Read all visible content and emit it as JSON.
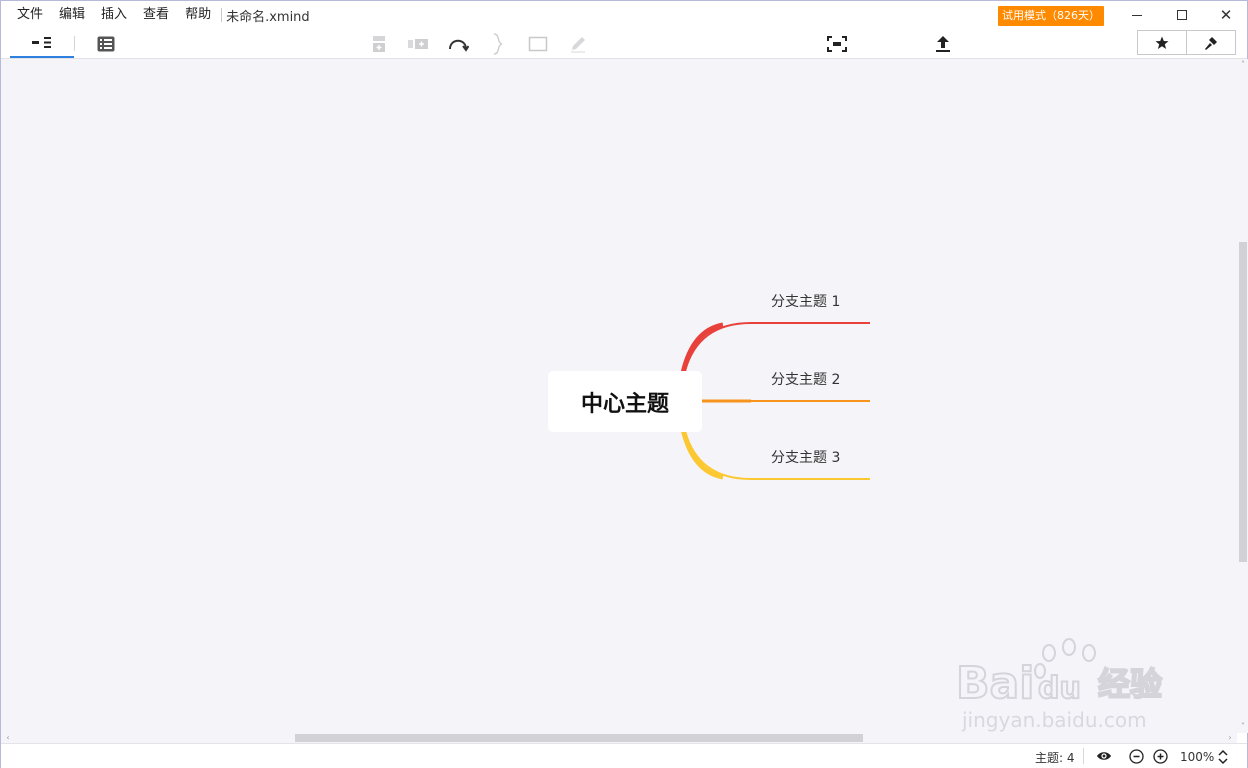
{
  "menu": {
    "items": [
      "文件",
      "编辑",
      "插入",
      "查看",
      "帮助"
    ],
    "document_title": "未命名.xmind"
  },
  "trial_badge": "试用模式（826天）",
  "toolbar": {
    "view_tabs": [
      "mindmap-view",
      "outline-view"
    ],
    "tools": [
      "subtopic-icon",
      "topic-icon",
      "relationship-icon",
      "summary-icon",
      "boundary-icon",
      "note-icon",
      "fit-map-icon",
      "share-export-icon"
    ],
    "right_tools": [
      "star-icon",
      "format-brush-icon"
    ]
  },
  "mindmap": {
    "central_topic": "中心主题",
    "branches": [
      {
        "label": "分支主题 1",
        "color": "#e8413b"
      },
      {
        "label": "分支主题 2",
        "color": "#f7941d"
      },
      {
        "label": "分支主题 3",
        "color": "#fcc831"
      }
    ]
  },
  "statusbar": {
    "topics_count": "主题: 4",
    "zoom": "100%"
  },
  "watermark": {
    "brand": "Bai du 经验",
    "url": "jingyan.baidu.com"
  },
  "colors": {
    "accent": "#2f7fe0",
    "trial": "#ff8a00",
    "canvas": "#f4f4f9"
  }
}
